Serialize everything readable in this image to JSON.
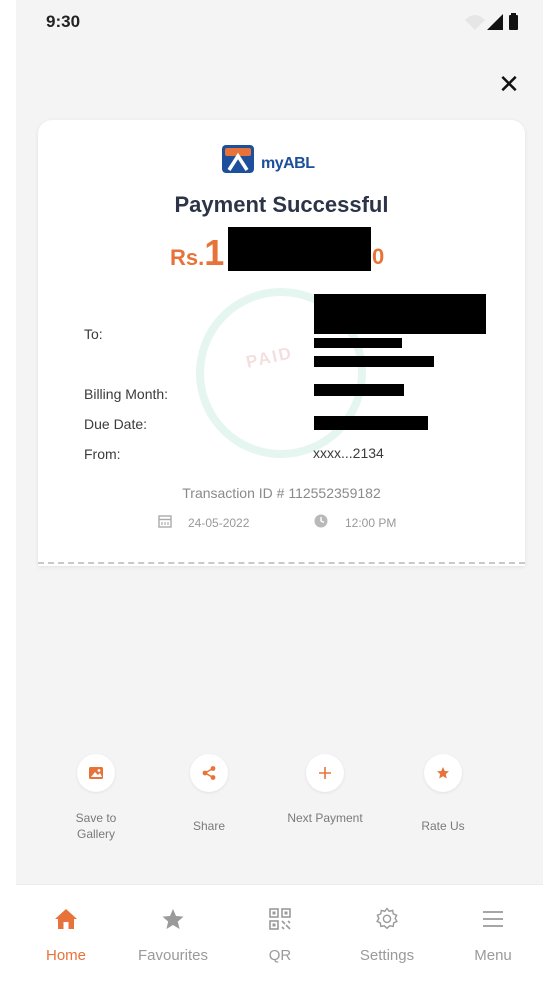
{
  "status_bar": {
    "time": "9:30"
  },
  "receipt": {
    "logo": {
      "prefix": "my",
      "brand": "ABL"
    },
    "title": "Payment Successful",
    "amount": {
      "currency": "Rs.",
      "visible_start": "1",
      "visible_end": "0"
    },
    "stamp_text": "PAID",
    "fields": [
      {
        "label": "To:",
        "value": ""
      },
      {
        "label": "Billing Month:",
        "value": ""
      },
      {
        "label": "Due Date:",
        "value": ""
      },
      {
        "label": "From:",
        "value": "xxxx...2134"
      }
    ],
    "transaction": "Transaction ID # 112552359182",
    "date": "24-05-2022",
    "time": "12:00 PM"
  },
  "actions": [
    {
      "label": "Save to Gallery",
      "icon": "image-icon"
    },
    {
      "label": "Share",
      "icon": "share-icon"
    },
    {
      "label": "Next Payment",
      "icon": "plus-icon"
    },
    {
      "label": "Rate Us",
      "icon": "star-icon"
    }
  ],
  "tabs": [
    {
      "label": "Home",
      "icon": "home-icon",
      "active": true
    },
    {
      "label": "Favourites",
      "icon": "star-icon",
      "active": false
    },
    {
      "label": "QR",
      "icon": "qr-icon",
      "active": false
    },
    {
      "label": "Settings",
      "icon": "gear-icon",
      "active": false
    },
    {
      "label": "Menu",
      "icon": "menu-icon",
      "active": false
    }
  ],
  "colors": {
    "accent": "#e8733a",
    "brand_blue": "#1d4f9b",
    "title": "#2d3447"
  }
}
